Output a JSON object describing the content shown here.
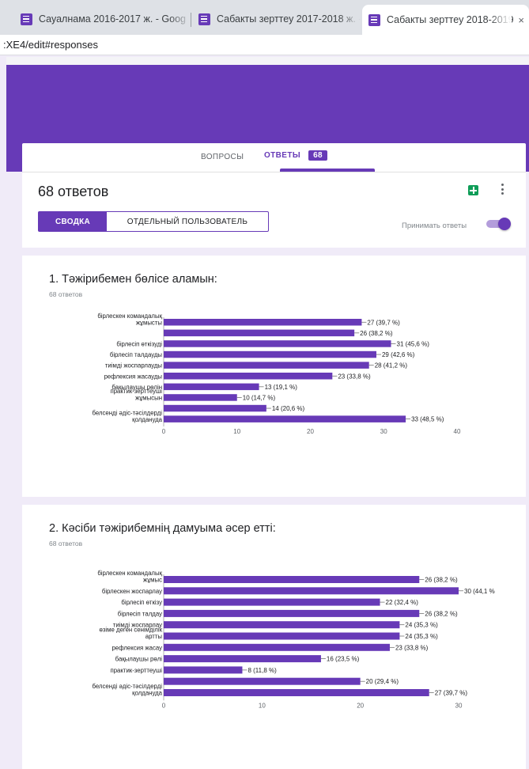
{
  "browser": {
    "tabs": [
      {
        "title": "Сауалнама 2016-2017 ж. - Goog"
      },
      {
        "title": "Сабакты зерттеу 2017-2018 ж. -"
      },
      {
        "title": "Сабакты зерттеу 2018-2019"
      }
    ],
    "close_glyph": "×",
    "address": ":XE4/edit#responses"
  },
  "nav": {
    "questions_label": "ВОПРОСЫ",
    "answers_label": "ОТВЕТЫ",
    "answers_count": "68"
  },
  "summary": {
    "title": "68 ответов",
    "summary_tab": "СВОДКА",
    "individual_tab": "ОТДЕЛЬНЫЙ ПОЛЬЗОВАТЕЛЬ",
    "accept_label": "Принимать ответы",
    "accepting": true
  },
  "questions": [
    {
      "title": "1. Тәжірибемен бөлісе аламын:",
      "count": "68 ответов"
    },
    {
      "title": "2. Кәсіби тәжірибемнің дамуыма әсер етті:",
      "count": "68 ответов"
    }
  ],
  "colors": {
    "accent": "#673ab7"
  },
  "chart_data": [
    {
      "type": "bar",
      "orientation": "horizontal",
      "categories": [
        "бірлескен командалық жұмысты",
        "",
        "бірлесіп өткізуді",
        "бірлесіп талдауды",
        "тиімді жоспарлауды",
        "рефлексия жасауды",
        "бақылаушы рөлін",
        "практик-зерттеуші жұмысын",
        "",
        "белсенді әдіс-тәсілдерді қолдануда"
      ],
      "values": [
        27,
        26,
        31,
        29,
        28,
        23,
        13,
        10,
        14,
        33
      ],
      "data_labels": [
        "27 (39,7 %)",
        "26 (38,2 %)",
        "31 (45,6 %)",
        "29 (42,6 %)",
        "28 (41,2 %)",
        "23 (33,8 %)",
        "13 (19,1 %)",
        "10 (14,7 %)",
        "14 (20,6 %)",
        "33 (48,5 %)"
      ],
      "xlim": [
        0,
        40
      ],
      "xticks": [
        "0",
        "10",
        "20",
        "30",
        "40"
      ]
    },
    {
      "type": "bar",
      "orientation": "horizontal",
      "categories": [
        "бірлескен командалық жұмыс",
        "бірлескен жоспарлау",
        "бірлесіп өткізу",
        "бірлесіп талдау",
        "тиімді жоспарлау",
        "өзіме деген сенімділік артты",
        "рефлексия жасау",
        "бақылаушы рөлі",
        "практик-зерттеуші",
        "",
        "белсенді әдіс-тәсілдерді қолдануда"
      ],
      "values": [
        26,
        30,
        22,
        26,
        24,
        24,
        23,
        16,
        8,
        20,
        27
      ],
      "data_labels": [
        "26 (38,2 %)",
        "30 (44,1 %",
        "22 (32,4 %)",
        "26 (38,2 %)",
        "24 (35,3 %)",
        "24 (35,3 %)",
        "23 (33,8 %)",
        "16 (23,5 %)",
        "8 (11,8 %)",
        "20 (29,4 %)",
        "27 (39,7 %)"
      ],
      "xlim": [
        0,
        30
      ],
      "xticks": [
        "0",
        "10",
        "20",
        "30"
      ]
    }
  ]
}
